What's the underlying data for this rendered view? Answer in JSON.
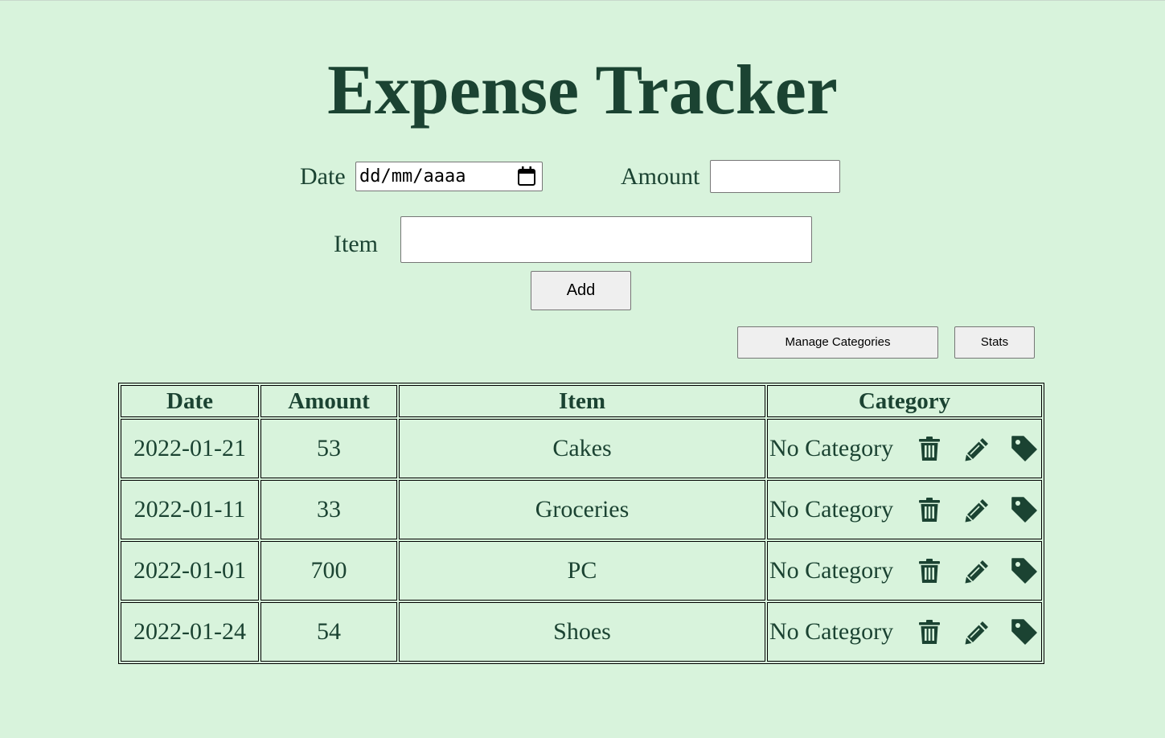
{
  "header": {
    "title": "Expense Tracker"
  },
  "form": {
    "date_label": "Date",
    "date_placeholder": "dd/mm/aaaa",
    "amount_label": "Amount",
    "amount_value": "",
    "item_label": "Item",
    "item_value": "",
    "add_label": "Add"
  },
  "actions": {
    "manage_categories_label": "Manage Categories",
    "stats_label": "Stats"
  },
  "table": {
    "headers": {
      "date": "Date",
      "amount": "Amount",
      "item": "Item",
      "category": "Category"
    },
    "rows": [
      {
        "date": "2022-01-21",
        "amount": "53",
        "item": "Cakes",
        "category": "No Category"
      },
      {
        "date": "2022-01-11",
        "amount": "33",
        "item": "Groceries",
        "category": "No Category"
      },
      {
        "date": "2022-01-01",
        "amount": "700",
        "item": "PC",
        "category": "No Category"
      },
      {
        "date": "2022-01-24",
        "amount": "54",
        "item": "Shoes",
        "category": "No Category"
      }
    ],
    "row_icons": [
      "trash-icon",
      "pencil-icon",
      "tag-icon"
    ]
  },
  "colors": {
    "background": "#d8f3dc",
    "text": "#1b4332",
    "button": "#efefef"
  }
}
